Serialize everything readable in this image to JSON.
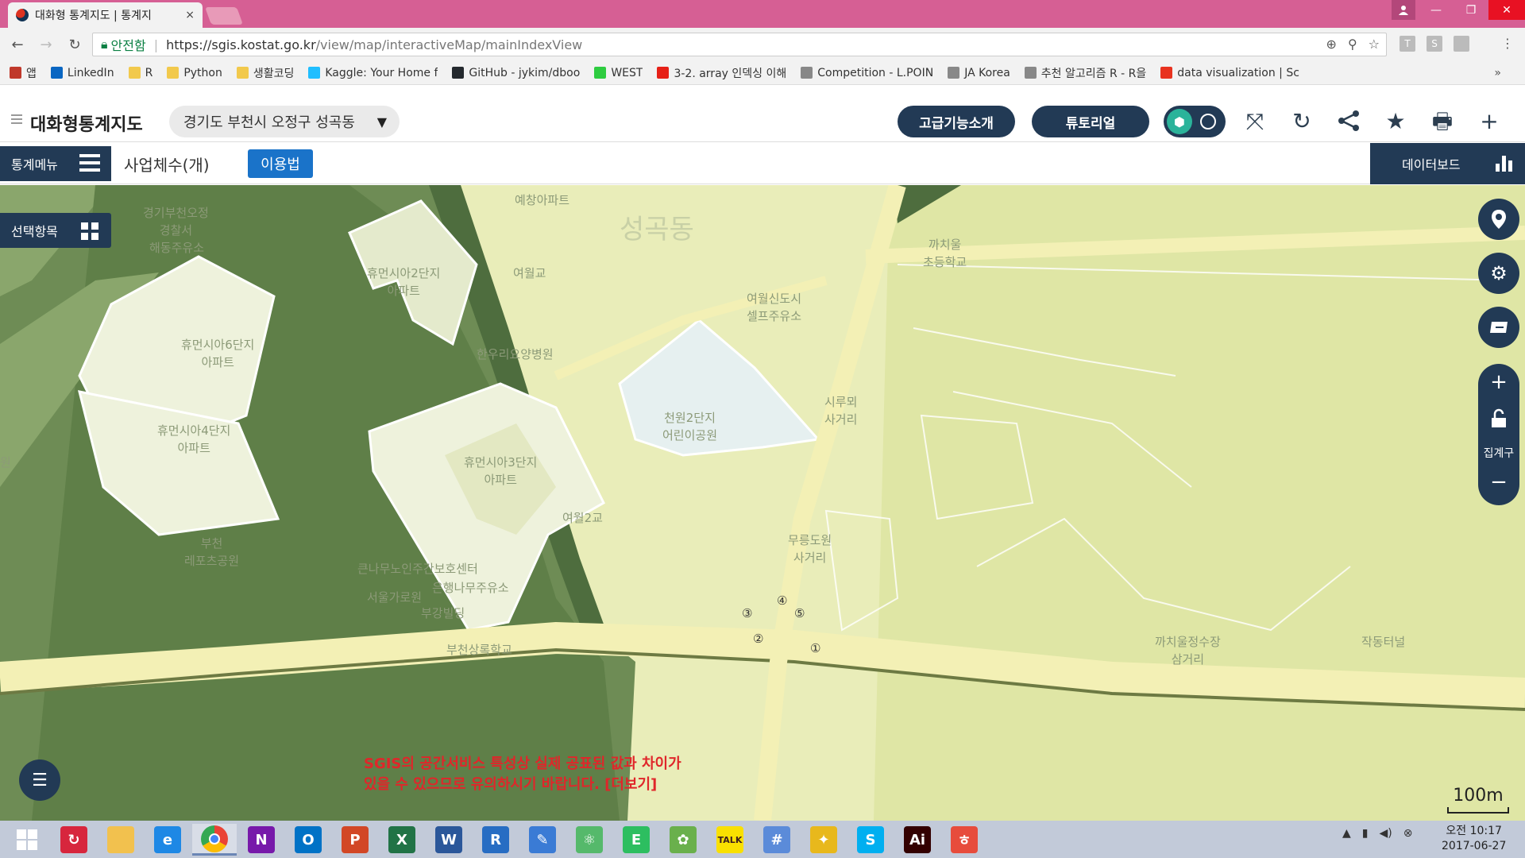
{
  "browser": {
    "tab_title": "대화형 통계지도 | 통계지",
    "tab_close": "×",
    "secure_label": "안전함",
    "url_host": "https://sgis.kostat.go.kr",
    "url_path": "/view/map/interactiveMap/mainIndexView",
    "nav": {
      "back": "←",
      "forward": "→",
      "reload": "↻"
    },
    "window": {
      "min": "—",
      "max": "❐",
      "close": "✕"
    },
    "ext_t": "T",
    "ext_s": "S",
    "menu": "⋮",
    "bookmarks": [
      {
        "label": "앱",
        "color": "#c0392b"
      },
      {
        "label": "LinkedIn",
        "color": "#0a66c2"
      },
      {
        "label": "R",
        "color": "#f2c94c"
      },
      {
        "label": "Python",
        "color": "#f2c94c"
      },
      {
        "label": "생활코딩",
        "color": "#f2c94c"
      },
      {
        "label": "Kaggle: Your Home f",
        "color": "#20beff"
      },
      {
        "label": "GitHub - jykim/dboo",
        "color": "#24292e"
      },
      {
        "label": "WEST",
        "color": "#2ecc40"
      },
      {
        "label": "3-2. array 인덱싱 이해",
        "color": "#e62117"
      },
      {
        "label": "Competition - L.POIN",
        "color": "#888888"
      },
      {
        "label": "JA Korea",
        "color": "#888888"
      },
      {
        "label": "추천 알고리즘 R - R을",
        "color": "#888888"
      },
      {
        "label": "data visualization | Sc",
        "color": "#e8321f"
      }
    ],
    "bookmarks_more": "»"
  },
  "app": {
    "name": "대화형통계지도",
    "region": "경기도 부천시 오정구 성곡동",
    "region_arrow": "▼",
    "btn_advanced": "고급기능소개",
    "btn_tutorial": "튜토리얼",
    "stat_menu": "통계메뉴",
    "stat_title": "사업체수(개)",
    "usage": "이용법",
    "dashboard": "데이터보드",
    "selected_items": "선택항목",
    "aggregate_label": "집계구",
    "zoom_in": "+",
    "zoom_out": "−"
  },
  "map": {
    "labels": {
      "police": "경기부천오정\n경찰서",
      "haedong": "해동주유소",
      "yechang": "예창아파트",
      "seonggok": "성곡동",
      "kkachiul": "까치울\n초등학교",
      "humen2": "휴먼시아2단지\n아파트",
      "humen6": "휴먼시아6단지\n아파트",
      "yeowol_gyo": "여월교",
      "yeowol_self": "여월신도시\n셀프주유소",
      "hanwoori": "한우리요양병원",
      "humen4": "휴먼시아4단지\n아파트",
      "humen3": "휴먼시아3단지\n아파트",
      "cheonwon": "천원2단지\n어린이공원",
      "sijang": "시루뫼\n사거리",
      "bucheon_leisure": "부천\n레포츠공원",
      "keunnamu": "큰나무노인주간보호센터",
      "eunhaeng": "은행나무주유소",
      "seoulgyo": "서울가로원",
      "bugang": "부강빌딩",
      "bucheonsang": "부천상록학교",
      "mureung": "무릉도원\n사거리",
      "kkachiul_water": "까치울정수장\n삼거리",
      "jakdong": "작동터널",
      "yeowol2": "여월2교",
      "left_edge": "원"
    },
    "notice_line1": "SGIS의 공간서비스 특성상 실제 공표된 값과 차이가",
    "notice_line2": "있을 수 있으므로 유의하시기 바랍니다. [더보기]",
    "scale": "100m",
    "road_markers": [
      "①",
      "②",
      "③",
      "④",
      "⑤"
    ]
  },
  "taskbar": {
    "apps": [
      {
        "name": "start-icon",
        "label": "",
        "color": "#ffffff"
      },
      {
        "name": "sync-app-icon",
        "label": "↻",
        "color": "#d7263d"
      },
      {
        "name": "file-explorer-icon",
        "label": "",
        "color": "#f2c14e"
      },
      {
        "name": "internet-explorer-icon",
        "label": "e",
        "color": "#1e88e5"
      },
      {
        "name": "chrome-icon",
        "label": "",
        "color": "#ea4335"
      },
      {
        "name": "onenote-icon",
        "label": "N",
        "color": "#7719aa"
      },
      {
        "name": "outlook-icon",
        "label": "O",
        "color": "#0072c6"
      },
      {
        "name": "powerpoint-icon",
        "label": "P",
        "color": "#d24726"
      },
      {
        "name": "excel-icon",
        "label": "X",
        "color": "#217346"
      },
      {
        "name": "word-icon",
        "label": "W",
        "color": "#2b579a"
      },
      {
        "name": "r-icon",
        "label": "R",
        "color": "#276dc3"
      },
      {
        "name": "notepad-icon",
        "label": "✎",
        "color": "#3a7bd5"
      },
      {
        "name": "atom-icon",
        "label": "⚛",
        "color": "#55b96b"
      },
      {
        "name": "evernote-icon",
        "label": "E",
        "color": "#2dbe60"
      },
      {
        "name": "paint-icon",
        "label": "✿",
        "color": "#6ab04c"
      },
      {
        "name": "kakaotalk-icon",
        "label": "TALK",
        "color": "#f9e000"
      },
      {
        "name": "snipping-icon",
        "label": "#",
        "color": "#5b8bd9"
      },
      {
        "name": "puzzle-icon",
        "label": "✦",
        "color": "#e8b81c"
      },
      {
        "name": "skype-icon",
        "label": "S",
        "color": "#00aff0"
      },
      {
        "name": "illustrator-icon",
        "label": "Ai",
        "color": "#330000"
      },
      {
        "name": "hanword-icon",
        "label": "ㅎ",
        "color": "#e74c3c"
      }
    ],
    "tray_up": "▲",
    "tray_battery": "▮",
    "tray_volume": "◀)",
    "tray_close": "⊗",
    "time": "오전 10:17",
    "date": "2017-06-27"
  }
}
